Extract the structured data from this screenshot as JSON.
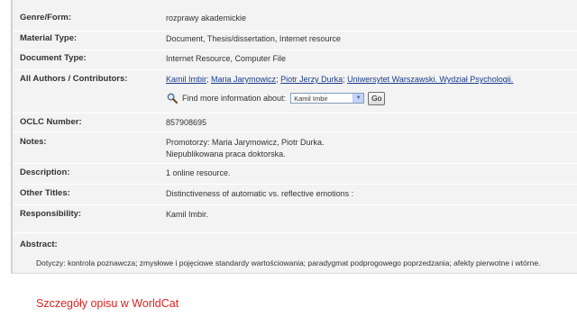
{
  "record": {
    "genre": {
      "label": "Genre/Form:",
      "value": "rozprawy akademickie"
    },
    "material_type": {
      "label": "Material Type:",
      "value": "Document, Thesis/dissertation, Internet resource"
    },
    "document_type": {
      "label": "Document Type:",
      "value": "Internet Resource, Computer File"
    },
    "authors": {
      "label": "All Authors / Contributors:",
      "items": [
        "Kamil Imbir",
        "Maria Jarymowicz",
        "Piotr Jerzy Durka",
        "Uniwersytet Warszawski. Wydział Psychologii."
      ],
      "separator": ";"
    },
    "find_more": {
      "icon": "magnifier-icon",
      "label": "Find more information about:",
      "selected": "Kamil Imbir",
      "go_label": "Go"
    },
    "oclc": {
      "label": "OCLC Number:",
      "value": "857908695"
    },
    "notes": {
      "label": "Notes:",
      "lines": [
        "Promotorzy: Maria Jarymowicz, Piotr Durka.",
        "Niepublikowana praca doktorska."
      ]
    },
    "description": {
      "label": "Description:",
      "value": "1 online resource."
    },
    "other_titles": {
      "label": "Other Titles:",
      "value": "Distinctiveness of automatic vs. reflective emotions :"
    },
    "responsibility": {
      "label": "Responsibility:",
      "value": "Kamil Imbir."
    },
    "abstract": {
      "label": "Abstract:",
      "text": "Dotyczy: kontrola poznawcza; zmysłowe i pojęciowe standardy wartościowania; paradygmat podprogowego poprzedzania; afekty pierwotne i wtórne."
    }
  },
  "footer": {
    "worldcat_link": "Szczegóły opisu w WorldCat"
  },
  "colors": {
    "panel_bg": "#f3f3f3",
    "link": "#1a3c8c",
    "worldcat_link": "#e02020"
  }
}
